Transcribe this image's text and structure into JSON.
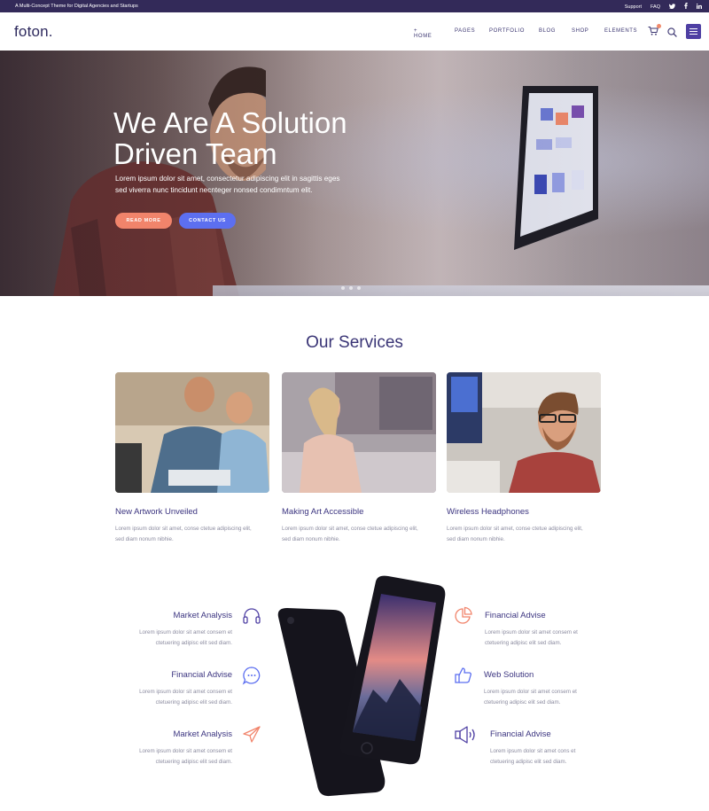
{
  "topbar": {
    "tagline": "A Multi-Concept Theme for Digital Agencies and Startups",
    "support": "Support",
    "faq": "FAQ",
    "social": [
      "twitter-icon",
      "facebook-icon",
      "linkedin-icon"
    ]
  },
  "header": {
    "logo": "foton.",
    "nav": [
      "+ HOME",
      "PAGES",
      "PORTFOLIO",
      "BLOG",
      "SHOP",
      "ELEMENTS"
    ]
  },
  "hero": {
    "title_line1": "We Are A Solution",
    "title_line2": "Driven Team",
    "subtitle_line1": "Lorem ipsum dolor sit amet, consectetur adipiscing elit in sagittis eges",
    "subtitle_line2": "sed viverra nunc tincidunt necnteger nonsed condimntum elit.",
    "read_more": "READ MORE",
    "contact_us": "CONTACT US"
  },
  "services": {
    "title": "Our Services",
    "cards": [
      {
        "title": "New Artwork Unveiled",
        "text_line1": "Lorem ipsum dolor sit amet, conse ctetue adipiscing elit,",
        "text_line2": "sed diam nonum nibhie."
      },
      {
        "title": "Making Art Accessible",
        "text_line1": "Lorem ipsum dolor sit amet, conse ctetue adipiscing elit,",
        "text_line2": "sed diam nonum nibhie."
      },
      {
        "title": "Wireless Headphones",
        "text_line1": "Lorem ipsum dolor sit amet, conse ctetue adipiscing elit,",
        "text_line2": "sed diam nonum nibhie."
      }
    ]
  },
  "features": {
    "left": [
      {
        "title": "Market Analysis",
        "line1": "Lorem ipsum dolor sit amet consem et",
        "line2": "ctetuering adipisc elit sed diam.",
        "icon": "headphones-icon"
      },
      {
        "title": "Financial Advise",
        "line1": "Lorem ipsum dolor sit amet consem et",
        "line2": "ctetuering adipisc elit sed diam.",
        "icon": "chat-bubble-icon"
      },
      {
        "title": "Market Analysis",
        "line1": "Lorem ipsum dolor sit amet consem et",
        "line2": "ctetuering adipisc elit sed diam.",
        "icon": "paper-plane-icon"
      }
    ],
    "right": [
      {
        "title": "Financial Advise",
        "line1": "Lorem ipsum dolor sit amet consem et",
        "line2": "ctetuering adipisc elit sed diam.",
        "icon": "pie-chart-icon"
      },
      {
        "title": "Web Solution",
        "line1": "Lorem ipsum dolor sit amet consem et",
        "line2": "ctetuering adipisc elit sed diam.",
        "icon": "thumbs-up-icon"
      },
      {
        "title": "Financial Advise",
        "line1": "Lorem ipsum dolor sit amet cons et",
        "line2": "ctetuering adipisc elit sed diam.",
        "icon": "megaphone-icon"
      }
    ]
  },
  "colors": {
    "accent": "#4e3fa3",
    "topbar": "#332a59",
    "coral": "#f1846b",
    "blue": "#5c6ff0"
  }
}
